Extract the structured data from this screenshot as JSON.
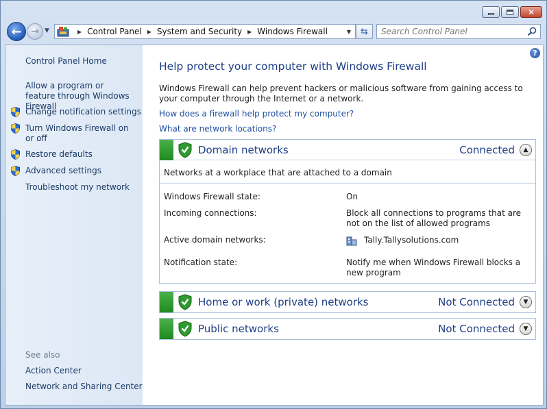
{
  "window": {
    "minimize_icon": "minimize-icon",
    "maximize_icon": "maximize-icon",
    "close_icon": "close-icon"
  },
  "navbar": {
    "breadcrumbs": [
      "Control Panel",
      "System and Security",
      "Windows Firewall"
    ],
    "search_placeholder": "Search Control Panel"
  },
  "sidebar": {
    "home": "Control Panel Home",
    "items": [
      {
        "label": "Allow a program or feature through Windows Firewall",
        "shield": false
      },
      {
        "label": "Change notification settings",
        "shield": true
      },
      {
        "label": "Turn Windows Firewall on or off",
        "shield": true
      },
      {
        "label": "Restore defaults",
        "shield": true
      },
      {
        "label": "Advanced settings",
        "shield": true
      },
      {
        "label": "Troubleshoot my network",
        "shield": false
      }
    ],
    "see_also_label": "See also",
    "see_also": [
      "Action Center",
      "Network and Sharing Center"
    ]
  },
  "main": {
    "help_glyph": "?",
    "title": "Help protect your computer with Windows Firewall",
    "description": "Windows Firewall can help prevent hackers or malicious software from gaining access to your computer through the Internet or a network.",
    "links": [
      "How does a firewall help protect my computer?",
      "What are network locations?"
    ],
    "panels": [
      {
        "title": "Domain networks",
        "status": "Connected",
        "expanded": true,
        "subtitle": "Networks at a workplace that are attached to a domain",
        "details": [
          {
            "label": "Windows Firewall state:",
            "value": "On"
          },
          {
            "label": "Incoming connections:",
            "value": "Block all connections to programs that are not on the list of allowed programs"
          },
          {
            "label": "Active domain networks:",
            "value": "Tally.Tallysolutions.com"
          },
          {
            "label": "Notification state:",
            "value": "Notify me when Windows Firewall blocks a new program"
          }
        ]
      },
      {
        "title": "Home or work (private) networks",
        "status": "Not Connected",
        "expanded": false
      },
      {
        "title": "Public networks",
        "status": "Not Connected",
        "expanded": false
      }
    ]
  },
  "colors": {
    "accent_green": "#2e9b2e",
    "link_blue": "#1e4ea0",
    "title_blue": "#1e3e87"
  }
}
